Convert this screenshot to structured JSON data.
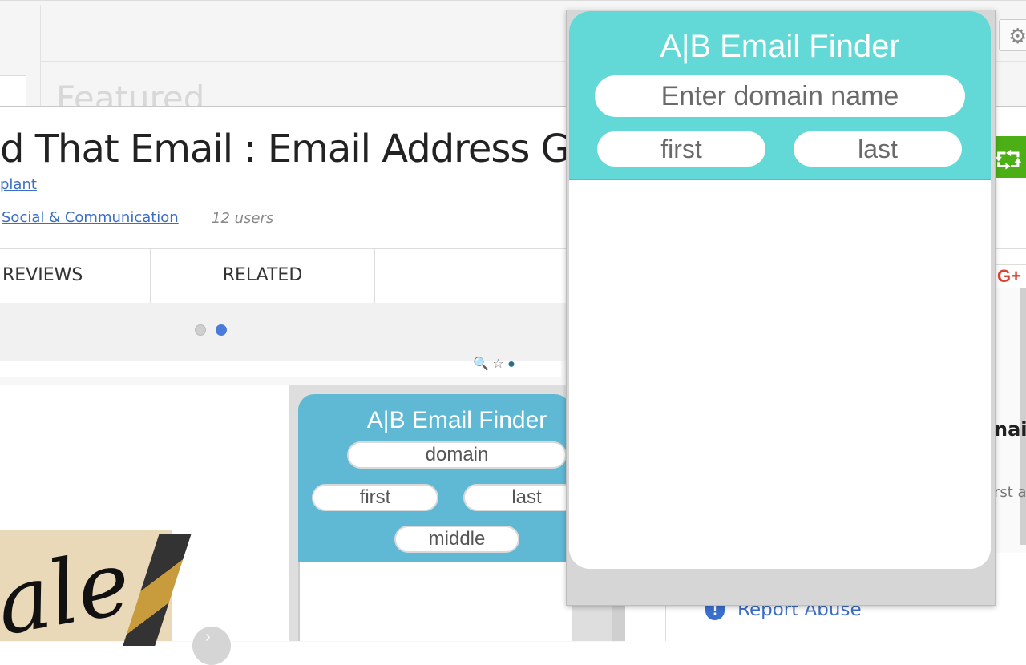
{
  "popup": {
    "title": "A|B Email Finder",
    "domain_placeholder": "Enter domain name",
    "first_placeholder": "first",
    "last_placeholder": "last",
    "header_color": "#62d9d6"
  },
  "store_page": {
    "featured_label": "Featured",
    "extension_title": "d That Email : Email Address Ge",
    "author_link": "plant",
    "category_link": "Social & Communication",
    "users_count": "12 users",
    "tabs": [
      {
        "label": "REVIEWS"
      },
      {
        "label": "RELATED"
      }
    ],
    "report_abuse": "Report Abuse",
    "side_text_1": "nair",
    "side_text_2": "rst a",
    "gplus_label": "G+"
  },
  "preview_popup": {
    "title": "A|B Email Finder",
    "domain_label": "domain",
    "first_label": "first",
    "last_label": "last",
    "middle_label": "middle",
    "artwork_text": "ale"
  },
  "icons": {
    "gear": "gear-icon",
    "share": "share-icon",
    "report": "report-icon"
  }
}
